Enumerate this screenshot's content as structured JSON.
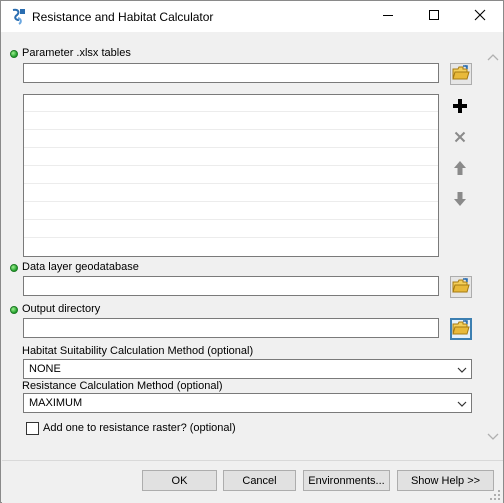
{
  "window": {
    "title": "Resistance and Habitat Calculator",
    "app_icon": "calculator-tool-icon",
    "controls": [
      "minimize-icon",
      "maximize-icon",
      "close-icon"
    ]
  },
  "form": {
    "param_tables": {
      "label": "Parameter .xlsx tables",
      "value": "",
      "required": true
    },
    "table_list": {
      "rows": []
    },
    "list_buttons": [
      "add-icon",
      "remove-icon",
      "move-up-icon",
      "move-down-icon"
    ],
    "data_gdb": {
      "label": "Data layer geodatabase",
      "value": "",
      "required": true
    },
    "output_dir": {
      "label": "Output directory",
      "value": "",
      "required": true
    },
    "habitat_method": {
      "label": "Habitat Suitability Calculation Method (optional)",
      "value": "NONE"
    },
    "resistance_method": {
      "label": "Resistance Calculation Method (optional)",
      "value": "MAXIMUM"
    },
    "add_one": {
      "label": "Add one to resistance raster? (optional)",
      "checked": false
    }
  },
  "footer": {
    "ok": "OK",
    "cancel": "Cancel",
    "environments": "Environments...",
    "show_help": "Show Help >>"
  },
  "colors": {
    "required_dot": "#1f9e2a",
    "folder": "#e8b93a",
    "selected_border": "#3c7fb1",
    "add_black": "#000000"
  }
}
